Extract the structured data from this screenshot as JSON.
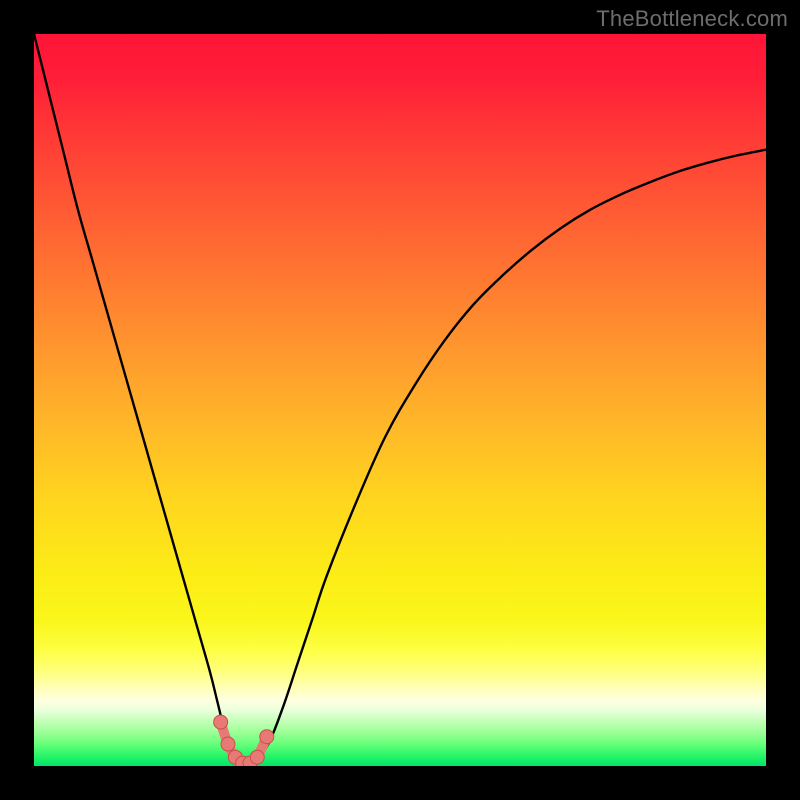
{
  "watermark": "TheBottleneck.com",
  "colors": {
    "frame": "#000000",
    "gradient_top": "#ff1437",
    "gradient_bottom": "#00e468",
    "curve": "#000000",
    "marker_fill": "#e77a75",
    "marker_stroke": "#c84f4a"
  },
  "chart_data": {
    "type": "line",
    "title": "",
    "xlabel": "",
    "ylabel": "",
    "xlim": [
      0,
      100
    ],
    "ylim": [
      0,
      100
    ],
    "grid": false,
    "series": [
      {
        "name": "bottleneck-curve",
        "x": [
          0,
          2,
          4,
          6,
          8,
          10,
          12,
          14,
          16,
          18,
          20,
          22,
          24,
          25,
          26,
          27,
          28,
          29,
          30,
          32,
          34,
          36,
          38,
          40,
          44,
          48,
          52,
          56,
          60,
          64,
          68,
          72,
          76,
          80,
          84,
          88,
          92,
          96,
          100
        ],
        "values": [
          100,
          92,
          84,
          76,
          69,
          62,
          55,
          48,
          41,
          34,
          27,
          20,
          13,
          9,
          5,
          2,
          0.5,
          0,
          0.5,
          3,
          8,
          14,
          20,
          26,
          36,
          45,
          52,
          58,
          63,
          67,
          70.5,
          73.5,
          76,
          78,
          79.7,
          81.2,
          82.4,
          83.4,
          84.2
        ]
      }
    ],
    "markers": {
      "name": "highlight-points",
      "x": [
        25.5,
        26.5,
        27.5,
        28.5,
        29.5,
        30.5,
        31.8
      ],
      "values": [
        6,
        3,
        1.2,
        0.4,
        0.4,
        1.2,
        4
      ]
    },
    "marker_connector": {
      "name": "highlight-connector",
      "x": [
        25.5,
        26.5,
        27.5,
        28.5,
        29.5,
        30.5,
        31.8
      ],
      "values": [
        6,
        3,
        1.2,
        0.4,
        0.4,
        1.2,
        4
      ]
    }
  }
}
